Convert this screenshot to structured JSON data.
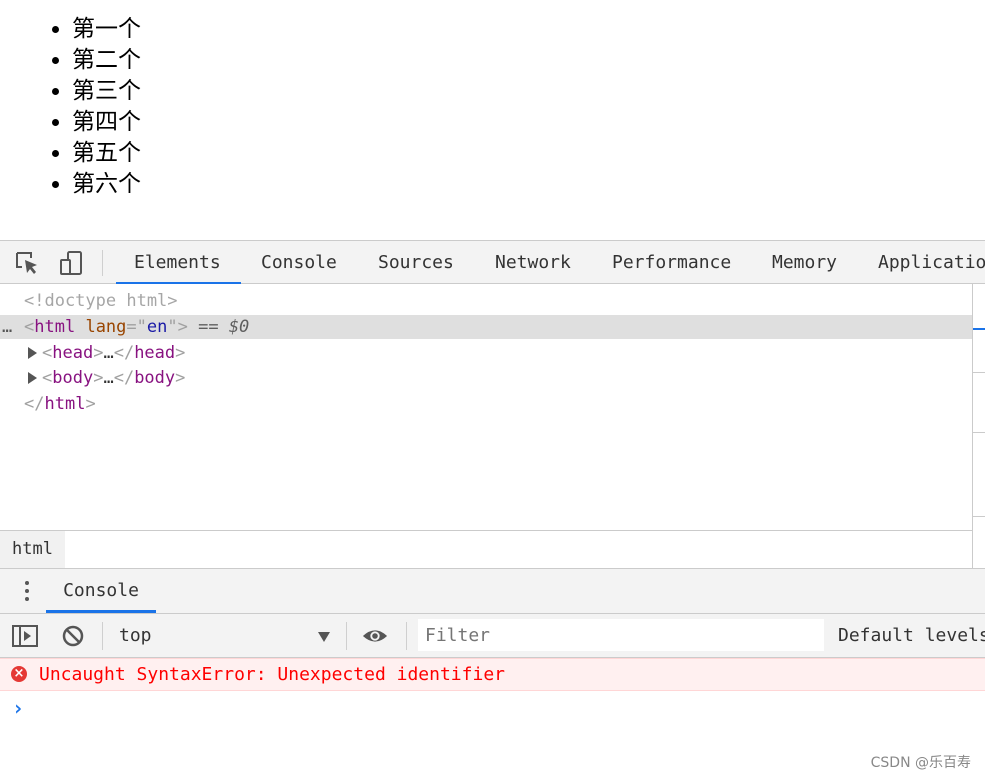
{
  "page": {
    "list_items": [
      "第一个",
      "第二个",
      "第三个",
      "第四个",
      "第五个",
      "第六个"
    ]
  },
  "devtools": {
    "tabs": [
      {
        "label": "Elements",
        "selected": true
      },
      {
        "label": "Console"
      },
      {
        "label": "Sources"
      },
      {
        "label": "Network"
      },
      {
        "label": "Performance"
      },
      {
        "label": "Memory"
      },
      {
        "label": "Applicatio"
      }
    ],
    "elements": {
      "doctype": "<!doctype html>",
      "html_open_tag": "html",
      "html_attr_name": "lang",
      "html_attr_value": "en",
      "selected_marker": "== $0",
      "head": {
        "tag": "head",
        "collapsed": "…"
      },
      "body": {
        "tag": "body",
        "collapsed": "…"
      },
      "html_close_tag": "html"
    },
    "breadcrumb": [
      "html"
    ],
    "drawer": {
      "tab": "Console",
      "context": "top",
      "filter_placeholder": "Filter",
      "levels": "Default levels"
    },
    "console": {
      "error": "Uncaught SyntaxError: Unexpected identifier",
      "prompt": "›"
    }
  },
  "watermark": "CSDN @乐百寿",
  "colors": {
    "accent": "#1a73e8",
    "error_text": "#ff0000",
    "error_bg": "#fff0f0",
    "tag": "#881280",
    "attr": "#994500",
    "attr_value": "#1a1aa6"
  }
}
